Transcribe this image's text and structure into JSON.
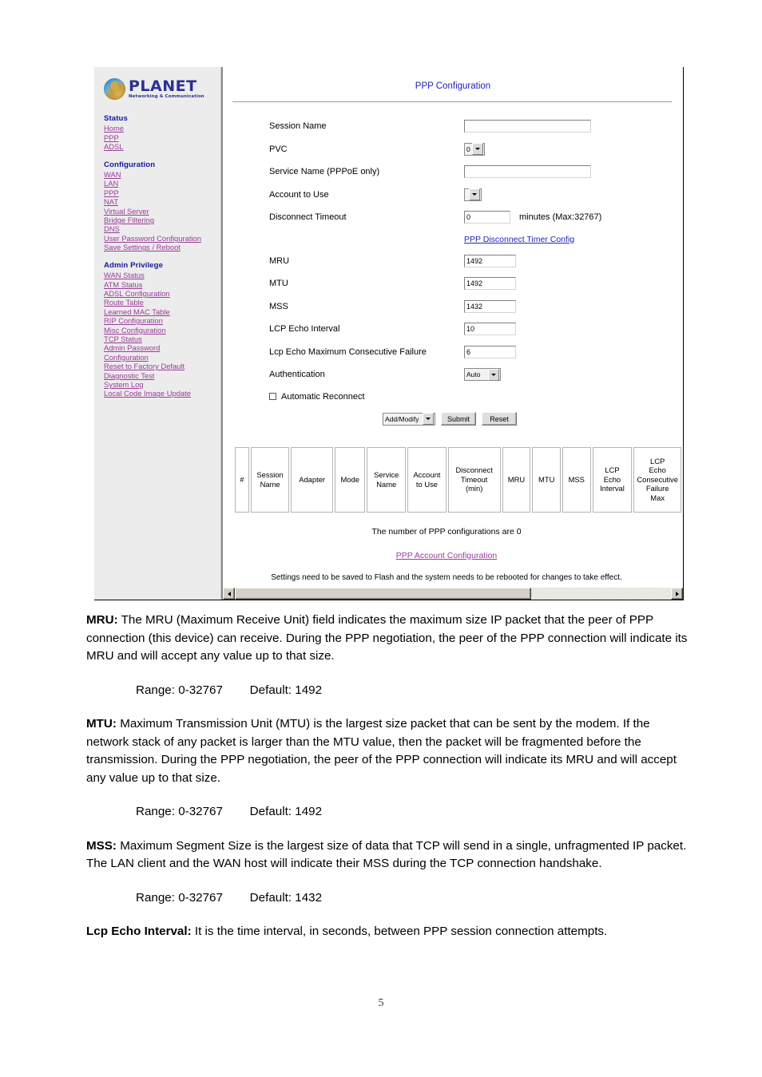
{
  "router_ui": {
    "brand": {
      "name": "PLANET",
      "tagline": "Networking & Communication",
      "logo_icon": "planet-globe-icon"
    },
    "sidebar": {
      "groups": [
        {
          "heading": "Status",
          "links": [
            "Home",
            "PPP",
            "ADSL"
          ]
        },
        {
          "heading": "Configuration",
          "links": [
            "WAN",
            "LAN",
            "PPP",
            "NAT",
            "Virtual Server",
            "Bridge Filtering",
            "DNS",
            "User Password Configuration",
            "Save Settings / Reboot"
          ]
        },
        {
          "heading": "Admin Privilege",
          "links": [
            "WAN Status",
            "ATM Status",
            "ADSL Configuration",
            "Route Table",
            "Learned MAC Table",
            "RIP Configuration",
            "Misc Configuration",
            "TCP Status",
            "Admin Password",
            "Configuration",
            "Reset to Factory Default",
            "Diagnostic Test",
            "System Log",
            "Local Code Image Update"
          ]
        }
      ]
    },
    "page_title": "PPP Configuration",
    "form": {
      "fields": [
        {
          "label": "Session Name",
          "type": "text",
          "value": ""
        },
        {
          "label": "PVC",
          "type": "select",
          "value": "0"
        },
        {
          "label": "Service Name (PPPoE only)",
          "type": "text",
          "value": ""
        },
        {
          "label": "Account to Use",
          "type": "select",
          "value": ""
        },
        {
          "label": "Disconnect Timeout",
          "type": "text",
          "value": "0",
          "suffix": "minutes (Max:32767)"
        },
        {
          "label": "MRU",
          "type": "text",
          "value": "1492"
        },
        {
          "label": "MTU",
          "type": "text",
          "value": "1492"
        },
        {
          "label": "MSS",
          "type": "text",
          "value": "1432"
        },
        {
          "label": "LCP Echo Interval",
          "type": "text",
          "value": "10"
        },
        {
          "label": "Lcp Echo Maximum Consecutive Failure",
          "type": "text",
          "value": "6"
        },
        {
          "label": "Authentication",
          "type": "select",
          "value": "Auto"
        }
      ],
      "disconnect_timer_link": "PPP Disconnect Timer Config",
      "auto_reconnect_label": "Automatic Reconnect",
      "auto_reconnect_checked": false,
      "action_select": "Add/Modify",
      "submit_label": "Submit",
      "reset_label": "Reset"
    },
    "table": {
      "headers": [
        "#",
        "Session\nName",
        "Adapter",
        "Mode",
        "Service\nName",
        "Account\nto Use",
        "Disconnect\nTimeout\n(min)",
        "MRU",
        "MTU",
        "MSS",
        "LCP\nEcho\nInterval",
        "LCP\nEcho\nConsecutive\nFailure\nMax"
      ],
      "rows": []
    },
    "count_text": "The number of PPP configurations are 0",
    "account_config_link": "PPP Account Configuration",
    "footer_note": "Settings need to be saved to Flash and the system needs to be rebooted for changes to take effect."
  },
  "document": {
    "paragraphs": [
      {
        "term": "MRU:",
        "text": " The MRU (Maximum Receive Unit) field indicates the maximum size IP packet that the peer of PPP connection (this device) can receive. During the PPP negotiation, the peer of the PPP connection will indicate its MRU and will accept any value up to that size.",
        "range": "Range: 0-32767        Default: 1492"
      },
      {
        "term": "MTU:",
        "text": " Maximum Transmission Unit (MTU) is the largest size packet that can be sent by the modem. If the network stack of any packet is larger than the MTU value, then the packet will be fragmented before the transmission. During the PPP negotiation, the peer of the PPP connection will indicate its MRU and will accept any value up to that size.",
        "range": "Range: 0-32767        Default: 1492"
      },
      {
        "term": "MSS:",
        "text": " Maximum Segment Size is the largest size of data that TCP will send in a single, unfragmented IP packet. The LAN client and the WAN host will indicate their MSS during the TCP connection handshake.",
        "range": "Range: 0-32767        Default: 1432"
      },
      {
        "term": "Lcp Echo Interval:",
        "text": " It is the time interval, in seconds, between PPP session connection attempts.",
        "range": ""
      }
    ],
    "page_number": "5"
  },
  "colors": {
    "heading_blue": "#16179C",
    "link_purple": "#9A3B9A",
    "title_blue": "#2020C0",
    "sidebar_bg": "#ECECEC"
  }
}
